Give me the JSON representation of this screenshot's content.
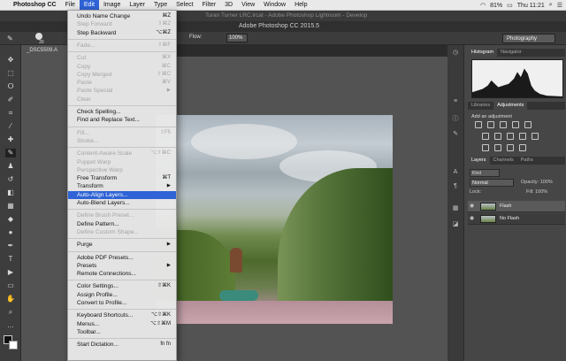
{
  "menubar": {
    "app_name": "Photoshop CC",
    "items": [
      "File",
      "Edit",
      "Image",
      "Layer",
      "Type",
      "Select",
      "Filter",
      "3D",
      "View",
      "Window",
      "Help"
    ],
    "battery": "81%",
    "time": "Thu 11:21"
  },
  "background_window_title": "Toran Turner LRC.lrcat - Adobe Photoshop Lightroom - Develop",
  "app_title": "Adobe Photoshop CC 2015.5",
  "options_bar": {
    "brush_size": "30",
    "flow_label": "Flow:",
    "flow_value": "100%",
    "workspace": "Photography"
  },
  "document_tab": "_DSC5509.A",
  "panels": {
    "histogram_tabs": [
      "Histogram",
      "Navigator"
    ],
    "adjust_tabs": [
      "Libraries",
      "Adjustments"
    ],
    "adjust_title": "Add an adjustment",
    "layers_tabs": [
      "Layers",
      "Channels",
      "Paths"
    ],
    "layer_filter": "Kind",
    "blend_mode": "Normal",
    "opacity": "Opacity: 100%",
    "lock": "Lock:",
    "fill": "Fill: 100%",
    "layers": [
      "Flash",
      "No Flash"
    ]
  },
  "edit_menu": [
    {
      "label": "Undo Name Change",
      "shortcut": "⌘Z",
      "disabled": false
    },
    {
      "label": "Step Forward",
      "shortcut": "⇧⌘Z",
      "disabled": true
    },
    {
      "label": "Step Backward",
      "shortcut": "⌥⌘Z",
      "disabled": false
    },
    {
      "sep": true
    },
    {
      "label": "Fade...",
      "shortcut": "⇧⌘F",
      "disabled": true
    },
    {
      "sep": true
    },
    {
      "label": "Cut",
      "shortcut": "⌘X",
      "disabled": true
    },
    {
      "label": "Copy",
      "shortcut": "⌘C",
      "disabled": true
    },
    {
      "label": "Copy Merged",
      "shortcut": "⇧⌘C",
      "disabled": true
    },
    {
      "label": "Paste",
      "shortcut": "⌘V",
      "disabled": true
    },
    {
      "label": "Paste Special",
      "submenu": true,
      "disabled": true
    },
    {
      "label": "Clear",
      "disabled": true
    },
    {
      "sep": true
    },
    {
      "label": "Check Spelling...",
      "disabled": false
    },
    {
      "label": "Find and Replace Text...",
      "disabled": false
    },
    {
      "sep": true
    },
    {
      "label": "Fill...",
      "shortcut": "⇧F5",
      "disabled": true
    },
    {
      "label": "Stroke...",
      "disabled": true
    },
    {
      "sep": true
    },
    {
      "label": "Content-Aware Scale",
      "shortcut": "⌥⇧⌘C",
      "disabled": true
    },
    {
      "label": "Puppet Warp",
      "disabled": true
    },
    {
      "label": "Perspective Warp",
      "disabled": true
    },
    {
      "label": "Free Transform",
      "shortcut": "⌘T",
      "disabled": false
    },
    {
      "label": "Transform",
      "submenu": true,
      "disabled": false
    },
    {
      "label": "Auto-Align Layers...",
      "disabled": false,
      "highlighted": true
    },
    {
      "label": "Auto-Blend Layers...",
      "disabled": false
    },
    {
      "sep": true
    },
    {
      "label": "Define Brush Preset...",
      "disabled": true
    },
    {
      "label": "Define Pattern...",
      "disabled": false
    },
    {
      "label": "Define Custom Shape...",
      "disabled": true
    },
    {
      "sep": true
    },
    {
      "label": "Purge",
      "submenu": true,
      "disabled": false
    },
    {
      "sep": true
    },
    {
      "label": "Adobe PDF Presets...",
      "disabled": false
    },
    {
      "label": "Presets",
      "submenu": true,
      "disabled": false
    },
    {
      "label": "Remote Connections...",
      "disabled": false
    },
    {
      "sep": true
    },
    {
      "label": "Color Settings...",
      "shortcut": "⇧⌘K",
      "disabled": false
    },
    {
      "label": "Assign Profile...",
      "disabled": false
    },
    {
      "label": "Convert to Profile...",
      "disabled": false
    },
    {
      "sep": true
    },
    {
      "label": "Keyboard Shortcuts...",
      "shortcut": "⌥⇧⌘K",
      "disabled": false
    },
    {
      "label": "Menus...",
      "shortcut": "⌥⇧⌘M",
      "disabled": false
    },
    {
      "label": "Toolbar...",
      "disabled": false
    },
    {
      "sep": true
    },
    {
      "label": "Start Dictation...",
      "shortcut": "fn fn",
      "disabled": false
    }
  ]
}
